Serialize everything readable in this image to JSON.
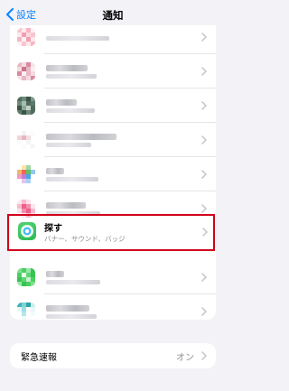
{
  "nav": {
    "back_label": "設定",
    "title": "通知"
  },
  "find_my": {
    "title": "探す",
    "subtitle": "バナー、サウンド、バッジ"
  },
  "emergency": {
    "label": "緊急速報",
    "value": "オン"
  },
  "colors": {
    "accent": "#0a84ff",
    "highlight_border": "#d0021b",
    "background": "#f2f2f7"
  },
  "icons": {
    "back": "chevron-left-icon",
    "row": "chevron-right-icon",
    "find_my": "find-my-icon"
  }
}
